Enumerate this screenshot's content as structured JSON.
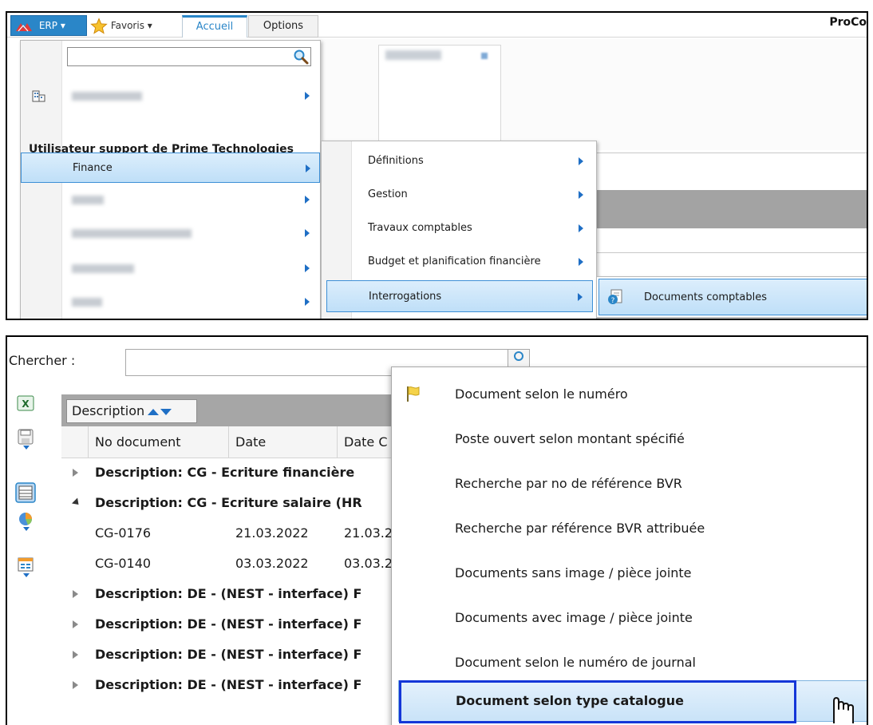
{
  "panel1": {
    "topbar": {
      "erp_label": "ERP",
      "favoris_label": "Favoris",
      "tab_accueil": "Accueil",
      "tab_options": "Options",
      "app_name": "ProCo"
    },
    "menu1": {
      "search_placeholder": "",
      "user_heading": "Utilisateur support de Prime Technologies",
      "selected_item": "Finance"
    },
    "menu2": {
      "items": [
        {
          "label": "Définitions"
        },
        {
          "label": "Gestion"
        },
        {
          "label": "Travaux comptables"
        },
        {
          "label": "Budget et planification financière"
        },
        {
          "label": "Interrogations"
        }
      ]
    },
    "menu3": {
      "item_label": "Documents comptables"
    }
  },
  "panel2": {
    "search_label": "Chercher :",
    "group_chip": "Description",
    "columns": {
      "no_document": "No document",
      "date": "Date",
      "date_c": "Date C"
    },
    "rows": {
      "g1": "Description: CG - Ecriture financière",
      "g2": "Description: CG - Ecriture salaire (HR",
      "r1_no": "CG-0176",
      "r1_date": "21.03.2022",
      "r1_date2": "21.03.2",
      "r2_no": "CG-0140",
      "r2_date": "03.03.2022",
      "r2_date2": "03.03.2",
      "g3": "Description: DE - (NEST - interface) F",
      "g4": "Description: DE - (NEST - interface) F",
      "g5": "Description: DE - (NEST - interface) F",
      "g6": "Description: DE - (NEST - interface) F"
    },
    "context_menu": {
      "items": [
        {
          "label": "Document selon le numéro"
        },
        {
          "label": "Poste ouvert selon montant spécifié"
        },
        {
          "label": "Recherche par no de référence BVR"
        },
        {
          "label": "Recherche par référence BVR attribuée"
        },
        {
          "label": "Documents sans image / pièce jointe"
        },
        {
          "label": "Documents avec image / pièce jointe"
        },
        {
          "label": "Document selon le numéro de journal"
        },
        {
          "label": "Document selon type catalogue"
        }
      ]
    }
  },
  "colors": {
    "accent": "#2a86c8",
    "selection_bg": "#bfdff8",
    "focus_border": "#1436d8",
    "grid_header": "#a6a6a6"
  }
}
